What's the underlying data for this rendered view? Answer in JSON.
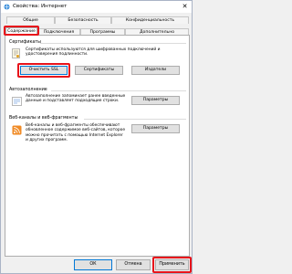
{
  "window": {
    "title": "Свойства: Интернет",
    "close_glyph": "✕"
  },
  "tabs": {
    "row1": [
      "Общие",
      "Безопасность",
      "Конфиденциальность"
    ],
    "row2": [
      "Содержание",
      "Подключения",
      "Программы",
      "Дополнительно"
    ],
    "active": "Содержание"
  },
  "certificates": {
    "group_label": "Сертификаты",
    "description": "Сертификаты используются для шифрованных подключений и удостоверения подлинности.",
    "buttons": {
      "clear_ssl": "Очистить SSL",
      "certificates": "Сертификаты",
      "publishers": "Издатели"
    }
  },
  "autocomplete": {
    "group_label": "Автозаполнение",
    "description": "Автозаполнение запоминает ранее введенные данные и подставляет подходящие строки.",
    "settings_button": "Параметры"
  },
  "feeds": {
    "group_label": "Веб-каналы и веб-фрагменты",
    "description": "Веб-каналы и веб-фрагменты обеспечивают обновленное содержимое веб-сайтов, которое можно прочитать с помощью Internet Explorer и других программ.",
    "settings_button": "Параметры"
  },
  "footer": {
    "ok": "ОК",
    "cancel": "Отмена",
    "apply": "Применить"
  },
  "colors": {
    "highlight": "#e8141b",
    "focus_border": "#0078d7"
  }
}
